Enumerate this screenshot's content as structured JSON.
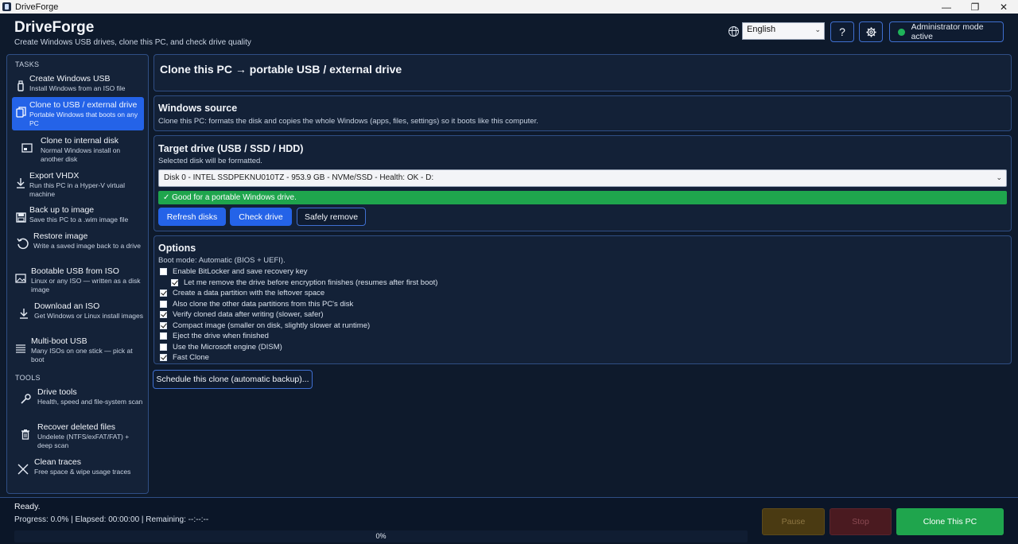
{
  "window": {
    "title": "DriveForge",
    "controls": [
      "—",
      "❐",
      "✕"
    ]
  },
  "header": {
    "brand": "DriveForge",
    "tagline": "Create Windows USB drives, clone this PC, and check drive quality",
    "language": "English",
    "help_label": "?",
    "settings_icon": "gear-icon",
    "admin_label": "Administrator mode active",
    "admin_status_color": "#1fb45a"
  },
  "sidebar": {
    "tasks_heading": "TASKS",
    "tools_heading": "TOOLS",
    "tasks": [
      {
        "label": "Create Windows USB",
        "desc": "Install Windows from an ISO file",
        "icon": "usb-drive-icon"
      },
      {
        "label": "Clone to USB / external drive",
        "desc": "Portable Windows that boots on any PC",
        "icon": "copy-icon",
        "active": true
      },
      {
        "label": "Clone to internal disk",
        "desc": "Normal Windows install on another disk",
        "icon": "internal-disk-icon"
      },
      {
        "label": "Export VHDX",
        "desc": "Run this PC in a Hyper-V virtual machine",
        "icon": "export-arrow-icon"
      },
      {
        "label": "Back up to image",
        "desc": "Save this PC to a .wim image file",
        "icon": "save-icon"
      },
      {
        "label": "Restore image",
        "desc": "Write a saved image back to a drive",
        "icon": "restore-icon"
      },
      {
        "label": "Bootable USB from ISO",
        "desc": "Linux or any ISO — written as a disk image",
        "icon": "image-icon"
      },
      {
        "label": "Download an ISO",
        "desc": "Get Windows or Linux install images",
        "icon": "download-icon"
      },
      {
        "label": "Multi-boot USB",
        "desc": "Many ISOs on one stick — pick at boot",
        "icon": "list-icon"
      }
    ],
    "tools": [
      {
        "label": "Drive tools",
        "desc": "Health, speed and file-system scan",
        "icon": "wrench-icon"
      },
      {
        "label": "Recover deleted files",
        "desc": "Undelete (NTFS/exFAT/FAT) + deep scan",
        "icon": "trash-icon"
      },
      {
        "label": "Clean traces",
        "desc": "Free space & wipe usage traces",
        "icon": "close-x-icon"
      }
    ]
  },
  "main": {
    "page_title": "Clone this PC → portable USB / external drive",
    "source": {
      "heading": "Windows source",
      "desc": "Clone this PC: formats the disk and copies the whole Windows (apps, files, settings) so it boots like this computer."
    },
    "target": {
      "heading": "Target drive (USB / SSD / HDD)",
      "note": "Selected disk will be formatted.",
      "selected_disk": "Disk 0 - INTEL SSDPEKNU010TZ - 953.9 GB - NVMe/SSD - Health: OK - D:",
      "health_message": "✓ Good for a portable Windows drive.",
      "refresh_label": "Refresh disks",
      "check_label": "Check drive",
      "safely_remove_label": "Safely remove"
    },
    "options": {
      "heading": "Options",
      "boot_mode": "Boot mode: Automatic (BIOS + UEFI).",
      "items": [
        {
          "label": "Enable BitLocker and save recovery key",
          "checked": false,
          "indent": false
        },
        {
          "label": "Let me remove the drive before encryption finishes (resumes after first boot)",
          "checked": true,
          "indent": true
        },
        {
          "label": "Create a data partition with the leftover space",
          "checked": true,
          "indent": false
        },
        {
          "label": "Also clone the other data partitions from this PC's disk",
          "checked": false,
          "indent": false
        },
        {
          "label": "Verify cloned data after writing (slower, safer)",
          "checked": true,
          "indent": false
        },
        {
          "label": "Compact image (smaller on disk, slightly slower at runtime)",
          "checked": true,
          "indent": false
        },
        {
          "label": "Eject the drive when finished",
          "checked": false,
          "indent": false
        },
        {
          "label": "Use the Microsoft engine (DISM)",
          "checked": false,
          "indent": false
        },
        {
          "label": "Fast Clone",
          "checked": true,
          "indent": false
        }
      ]
    },
    "schedule_label": "Schedule this clone (automatic backup)..."
  },
  "footer": {
    "status": "Ready.",
    "progress_text": "Progress: 0.0% | Elapsed: 00:00:00 | Remaining: --:--:--",
    "progress_percent_label": "0%",
    "progress_fraction": 0,
    "pause_label": "Pause",
    "stop_label": "Stop",
    "clone_label": "Clone This PC"
  }
}
